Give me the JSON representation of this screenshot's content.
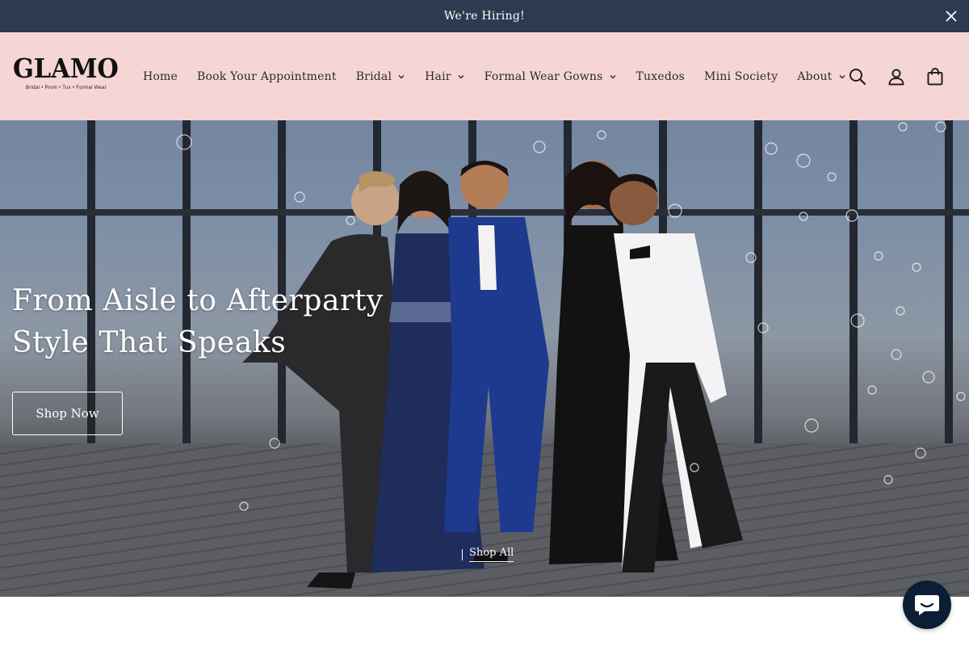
{
  "announcement": {
    "text": "We're Hiring!"
  },
  "brand": {
    "logo_text": "GLAMO",
    "logo_tagline": "Bridal • Prom • Tux • Formal Wear"
  },
  "nav": {
    "items": [
      {
        "label": "Home",
        "has_dropdown": false
      },
      {
        "label": "Book Your Appointment",
        "has_dropdown": false
      },
      {
        "label": "Bridal",
        "has_dropdown": true
      },
      {
        "label": "Hair",
        "has_dropdown": true
      },
      {
        "label": "Formal Wear Gowns",
        "has_dropdown": true
      },
      {
        "label": "Tuxedos",
        "has_dropdown": false
      },
      {
        "label": "Mini Society",
        "has_dropdown": false
      },
      {
        "label": "About",
        "has_dropdown": true
      }
    ]
  },
  "header_icons": [
    "search-icon",
    "account-icon",
    "cart-icon"
  ],
  "hero": {
    "heading_line1": "From Aisle to Afterparty",
    "heading_line2": "Style That Speaks",
    "button_label": "Shop Now",
    "shop_all_label": "Shop All"
  },
  "colors": {
    "announcement_bg": "#2e3a4f",
    "header_bg": "#f6d5d5",
    "chat_bg": "#0b1e33"
  }
}
